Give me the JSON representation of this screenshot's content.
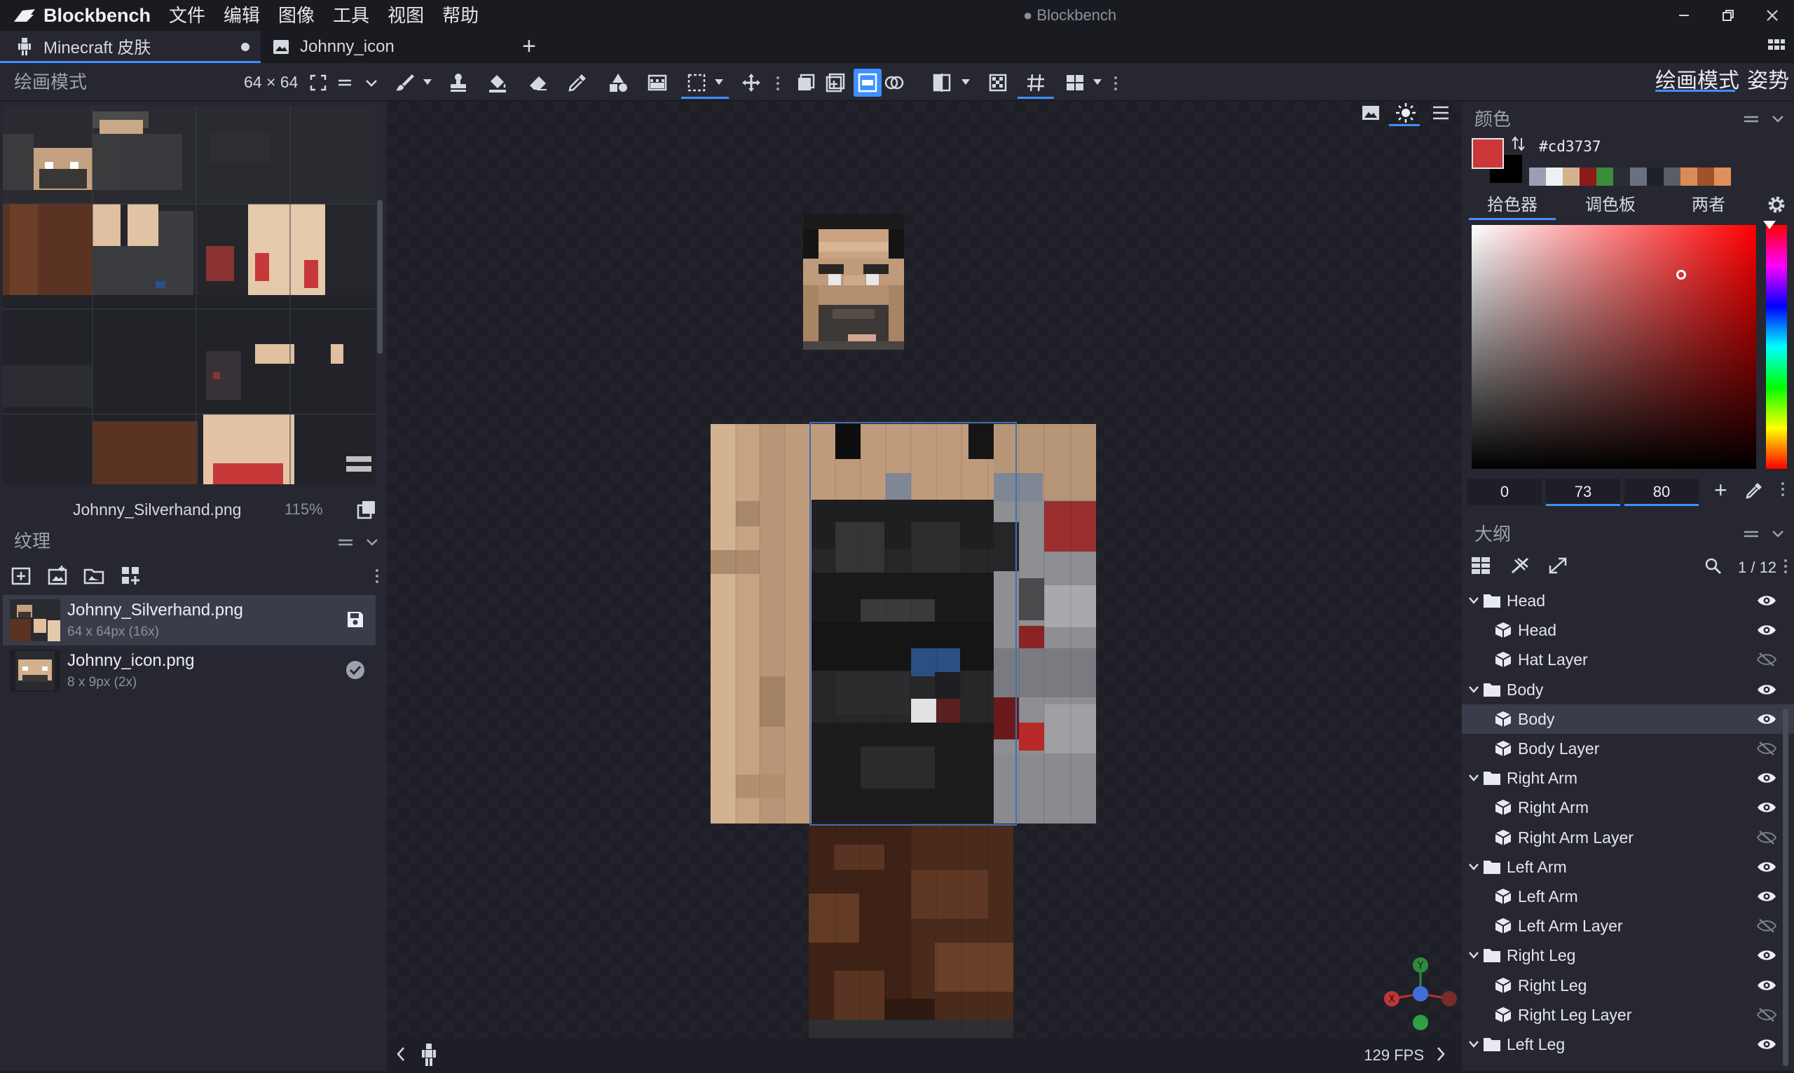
{
  "app": {
    "name": "Blockbench",
    "window_title": "Blockbench",
    "menu": [
      "文件",
      "编辑",
      "图像",
      "工具",
      "视图",
      "帮助"
    ]
  },
  "tabs": [
    {
      "label": "Minecraft 皮肤",
      "active": true,
      "unsaved": true
    },
    {
      "label": "Johnny_icon",
      "active": false
    }
  ],
  "toolbar": {
    "mode_label": "绘画模式",
    "canvas_size": "64 × 64",
    "mode_tabs": [
      "绘画模式",
      "姿势"
    ]
  },
  "uv_panel": {
    "filename": "Johnny_Silverhand.png",
    "zoom": "115%"
  },
  "textures": {
    "header": "纹理",
    "items": [
      {
        "name": "Johnny_Silverhand.png",
        "meta": "64 x 64px (16x)",
        "selected": true,
        "status_icon": "save-icon"
      },
      {
        "name": "Johnny_icon.png",
        "meta": "8 x 9px (2x)",
        "selected": false,
        "status_icon": "check-circle-icon"
      }
    ]
  },
  "viewport": {
    "fps": "129 FPS"
  },
  "color_panel": {
    "header": "颜色",
    "hex": "#cd3737",
    "main_color": "#cd3737",
    "secondary_color": "#000000",
    "palette": [
      "#9aa0b4",
      "#eef0f4",
      "#d2b48c",
      "#8b1a1a",
      "#3c8c3c",
      "#2b2d36",
      "#6a7080",
      "#1f2128",
      "#5a5d66",
      "#d98c55",
      "#a0522d",
      "#e0905a"
    ],
    "tabs": [
      "拾色器",
      "调色板",
      "两者"
    ],
    "active_tab": "拾色器",
    "hsv": {
      "h": "0",
      "s": "73",
      "v": "80"
    }
  },
  "outliner": {
    "header": "大纲",
    "count": "1 / 12",
    "tree": [
      {
        "label": "Head",
        "type": "group",
        "visible": true
      },
      {
        "label": "Head",
        "type": "cube",
        "visible": true
      },
      {
        "label": "Hat Layer",
        "type": "cube",
        "visible": false
      },
      {
        "label": "Body",
        "type": "group",
        "visible": true
      },
      {
        "label": "Body",
        "type": "cube",
        "visible": true,
        "selected": true
      },
      {
        "label": "Body Layer",
        "type": "cube",
        "visible": false
      },
      {
        "label": "Right Arm",
        "type": "group",
        "visible": true
      },
      {
        "label": "Right Arm",
        "type": "cube",
        "visible": true
      },
      {
        "label": "Right Arm Layer",
        "type": "cube",
        "visible": false
      },
      {
        "label": "Left Arm",
        "type": "group",
        "visible": true
      },
      {
        "label": "Left Arm",
        "type": "cube",
        "visible": true
      },
      {
        "label": "Left Arm Layer",
        "type": "cube",
        "visible": false
      },
      {
        "label": "Right Leg",
        "type": "group",
        "visible": true
      },
      {
        "label": "Right Leg",
        "type": "cube",
        "visible": true
      },
      {
        "label": "Right Leg Layer",
        "type": "cube",
        "visible": false
      },
      {
        "label": "Left Leg",
        "type": "group",
        "visible": true
      }
    ]
  },
  "colors": {
    "accent": "#3e90ff",
    "panel": "#262730",
    "background": "#1e1f26"
  }
}
